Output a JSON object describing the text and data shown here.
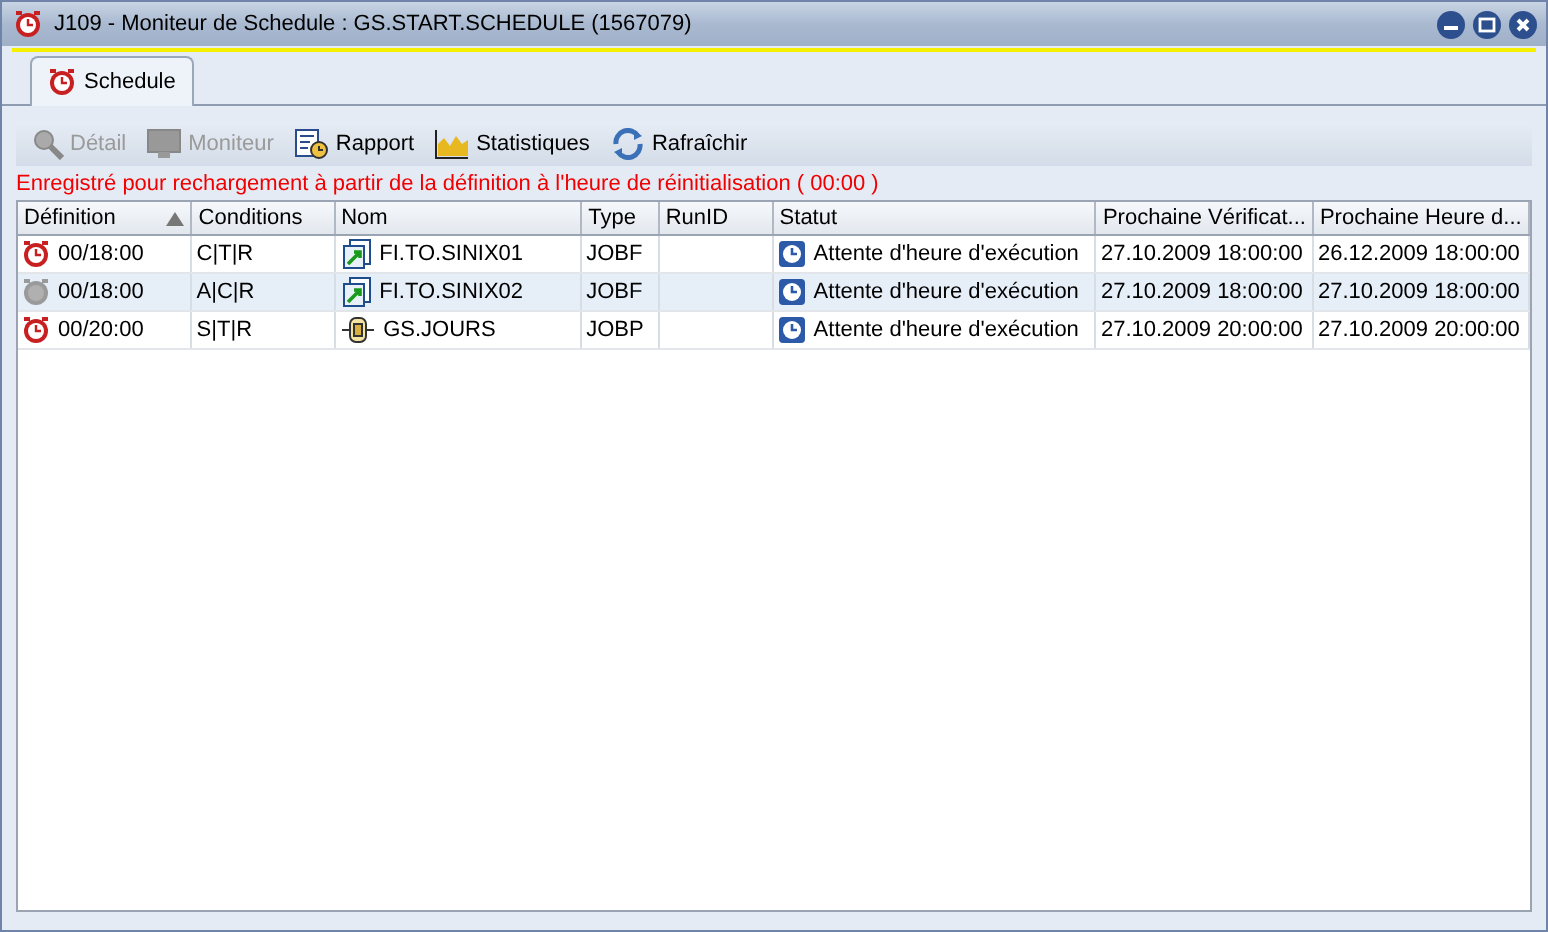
{
  "window": {
    "title": "J109 - Moniteur de Schedule : GS.START.SCHEDULE (1567079)"
  },
  "tabs": [
    {
      "label": "Schedule",
      "selected": true
    }
  ],
  "toolbar": [
    {
      "kind": "detail",
      "label": "Détail",
      "disabled": true
    },
    {
      "kind": "monitor",
      "label": "Moniteur",
      "disabled": true
    },
    {
      "kind": "report",
      "label": "Rapport",
      "disabled": false
    },
    {
      "kind": "stats",
      "label": "Statistiques",
      "disabled": false
    },
    {
      "kind": "refresh",
      "label": "Rafraîchir",
      "disabled": false
    }
  ],
  "message": "Enregistré pour rechargement à partir de la définition à l'heure de réinitialisation ( 00:00 )",
  "table": {
    "columns": [
      {
        "label": "Définition",
        "sorted": true
      },
      {
        "label": "Conditions",
        "sorted": false
      },
      {
        "label": "Nom",
        "sorted": false
      },
      {
        "label": "Type",
        "sorted": false
      },
      {
        "label": "RunID",
        "sorted": false
      },
      {
        "label": "Statut",
        "sorted": false
      },
      {
        "label": "Prochaine Vérificat...",
        "sorted": false
      },
      {
        "label": "Prochaine Heure d...",
        "sorted": false
      }
    ],
    "rows": [
      {
        "kind": "jobf",
        "active": true,
        "definition": "00/18:00",
        "conditions": "C|T|R",
        "name": "FI.TO.SINIX01",
        "type": "JOBF",
        "status": "Attente d'heure d'exécution",
        "next_check": "27.10.2009 18:00:00",
        "next_time": "26.12.2009 18:00:00"
      },
      {
        "kind": "jobf",
        "active": false,
        "definition": "00/18:00",
        "conditions": "A|C|R",
        "name": "FI.TO.SINIX02",
        "type": "JOBF",
        "status": "Attente d'heure d'exécution",
        "next_check": "27.10.2009 18:00:00",
        "next_time": "27.10.2009 18:00:00"
      },
      {
        "kind": "jobp",
        "active": true,
        "definition": "00/20:00",
        "conditions": "S|T|R",
        "name": "GS.JOURS",
        "type": "JOBP",
        "status": "Attente d'heure d'exécution",
        "next_check": "27.10.2009 20:00:00",
        "next_time": "27.10.2009 20:00:00"
      }
    ]
  }
}
